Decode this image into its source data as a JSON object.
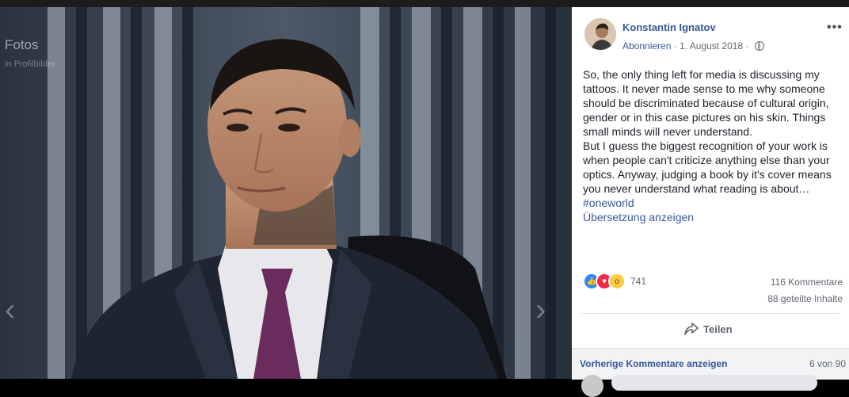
{
  "viewer": {
    "album_title": "Fotos",
    "album_subtitle": "in Profilbilder",
    "prev_arrow": "‹",
    "next_arrow": "›"
  },
  "post": {
    "author": "Konstantin Ignatov",
    "subscribe_label": "Abonnieren",
    "separator": " · ",
    "date": "1. August 2018",
    "separator2": " · ",
    "more_label": "•••",
    "paragraphs": [
      "So, the only thing left for media is discussing my tattoos. It never made sense to me why someone should be discriminated because of cultural origin, gender or in this case pictures on his skin. Things small minds will never understand.",
      "But I guess the biggest recognition of your work is when people can't criticize anything else than your optics. Anyway, judging a book by it's cover means you never understand what reading is about…"
    ],
    "hashtag": "#oneworld",
    "translate_label": "Übersetzung anzeigen",
    "reaction_count": "741",
    "comments_count": "116 Kommentare",
    "shares_count": "88 geteilte Inhalte",
    "share_label": "Teilen"
  },
  "comments": {
    "previous_label": "Vorherige Kommentare anzeigen",
    "position": "6 von 90"
  },
  "icons": {
    "reactions": [
      "like-icon",
      "love-icon",
      "wow-icon"
    ],
    "share": "share-arrow-icon",
    "privacy": "globe-icon"
  },
  "colors": {
    "link": "#365899",
    "like": "#2e89ff",
    "love": "#f0284a",
    "wow": "#fbcd42"
  }
}
